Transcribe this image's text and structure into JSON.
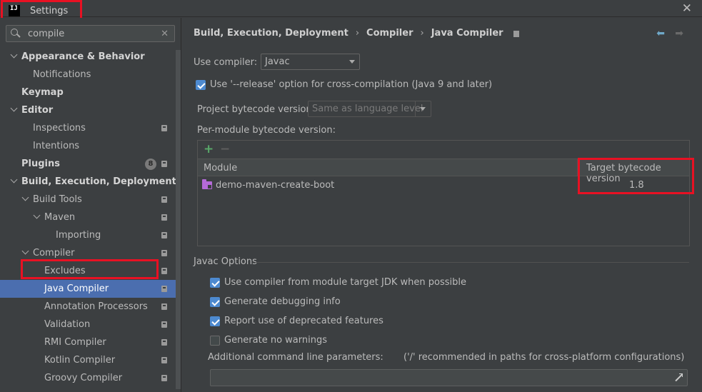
{
  "window": {
    "title": "Settings",
    "logo_text": "IJ"
  },
  "sidebar": {
    "search": {
      "value": "compile"
    },
    "items": [
      {
        "label": "Appearance & Behavior",
        "level": 0,
        "bold": true,
        "arrow": true,
        "proj": false,
        "badge": ""
      },
      {
        "label": "Notifications",
        "level": 1,
        "bold": false,
        "arrow": false,
        "proj": false,
        "badge": ""
      },
      {
        "label": "Keymap",
        "level": 0,
        "bold": true,
        "arrow": false,
        "proj": false,
        "badge": ""
      },
      {
        "label": "Editor",
        "level": 0,
        "bold": true,
        "arrow": true,
        "proj": false,
        "badge": ""
      },
      {
        "label": "Inspections",
        "level": 1,
        "bold": false,
        "arrow": false,
        "proj": true,
        "badge": ""
      },
      {
        "label": "Intentions",
        "level": 1,
        "bold": false,
        "arrow": false,
        "proj": false,
        "badge": ""
      },
      {
        "label": "Plugins",
        "level": 0,
        "bold": true,
        "arrow": false,
        "proj": true,
        "badge": "8"
      },
      {
        "label": "Build, Execution, Deployment",
        "level": 0,
        "bold": true,
        "arrow": true,
        "proj": false,
        "badge": ""
      },
      {
        "label": "Build Tools",
        "level": 1,
        "bold": false,
        "arrow": true,
        "proj": true,
        "badge": ""
      },
      {
        "label": "Maven",
        "level": 2,
        "bold": false,
        "arrow": true,
        "proj": true,
        "badge": ""
      },
      {
        "label": "Importing",
        "level": 3,
        "bold": false,
        "arrow": false,
        "proj": true,
        "badge": ""
      },
      {
        "label": "Compiler",
        "level": 1,
        "bold": false,
        "arrow": true,
        "proj": true,
        "badge": ""
      },
      {
        "label": "Excludes",
        "level": 2,
        "bold": false,
        "arrow": false,
        "proj": true,
        "badge": ""
      },
      {
        "label": "Java Compiler",
        "level": 2,
        "bold": false,
        "arrow": false,
        "proj": true,
        "badge": "",
        "selected": true
      },
      {
        "label": "Annotation Processors",
        "level": 2,
        "bold": false,
        "arrow": false,
        "proj": true,
        "badge": ""
      },
      {
        "label": "Validation",
        "level": 2,
        "bold": false,
        "arrow": false,
        "proj": true,
        "badge": ""
      },
      {
        "label": "RMI Compiler",
        "level": 2,
        "bold": false,
        "arrow": false,
        "proj": true,
        "badge": ""
      },
      {
        "label": "Kotlin Compiler",
        "level": 2,
        "bold": false,
        "arrow": false,
        "proj": true,
        "badge": ""
      },
      {
        "label": "Groovy Compiler",
        "level": 2,
        "bold": false,
        "arrow": false,
        "proj": true,
        "badge": ""
      }
    ]
  },
  "main": {
    "breadcrumb": [
      "Build, Execution, Deployment",
      "Compiler",
      "Java Compiler"
    ],
    "use_compiler_label": "Use compiler:",
    "use_compiler_value": "Javac",
    "release_option_label": "Use '--release' option for cross-compilation (Java 9 and later)",
    "project_bytecode_label": "Project bytecode version:",
    "project_bytecode_value": "Same as language level",
    "per_module_label": "Per-module bytecode version:",
    "table": {
      "col_module": "Module",
      "col_target": "Target bytecode version",
      "rows": [
        {
          "module": "demo-maven-create-boot",
          "target": "1.8"
        }
      ]
    },
    "javac_options_title": "Javac Options",
    "options": [
      {
        "label": "Use compiler from module target JDK when possible",
        "checked": true
      },
      {
        "label": "Generate debugging info",
        "checked": true
      },
      {
        "label": "Report use of deprecated features",
        "checked": true
      },
      {
        "label": "Generate no warnings",
        "checked": false
      }
    ],
    "additional_params_label": "Additional command line parameters:",
    "additional_params_hint": "('/' recommended in paths for cross-platform configurations)"
  }
}
